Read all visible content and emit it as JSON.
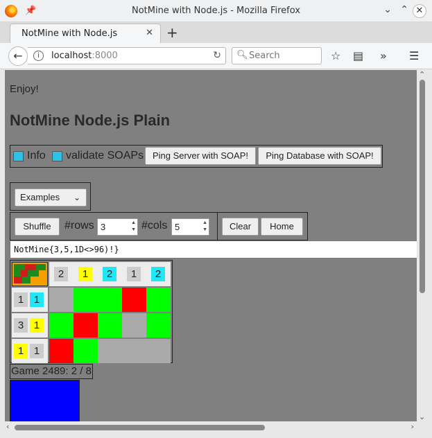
{
  "window": {
    "title": "NotMine with Node.js - Mozilla Firefox"
  },
  "tab": {
    "label": "NotMine with Node.js",
    "close": "✕"
  },
  "nav": {
    "url_host": "localhost",
    "url_port": ":8000",
    "search_placeholder": "Search"
  },
  "page": {
    "enjoy": "Enjoy!",
    "heading": "NotMine Node.js Plain",
    "info_label": "Info",
    "validate_label": "validate SOAPs",
    "ping_server": "Ping Server with SOAP!",
    "ping_database": "Ping Database with SOAP!",
    "examples_select": "Examples",
    "shuffle": "Shuffle",
    "rows_label": "#rows",
    "rows_value": "3",
    "cols_label": "#cols",
    "cols_value": "5",
    "clear": "Clear",
    "home": "Home",
    "code": "NotMine{3,5,1D<>96)!}",
    "status": "Game 2489: 2 / 8"
  },
  "colors": {
    "background": "#808080",
    "green": "#00ff00",
    "red": "#ff0000",
    "gray": "#aaaaaa",
    "yellow": "#ffff00",
    "cyan": "#22e5f5",
    "blue": "#0000ff",
    "hint_gray": "#cccccc"
  },
  "board": {
    "column_hints": [
      {
        "value": "2",
        "color": "#cccccc"
      },
      {
        "value": "1",
        "color": "#ffff00"
      },
      {
        "value": "2",
        "color": "#22e5f5"
      },
      {
        "value": "1",
        "color": "#cccccc"
      },
      {
        "value": "2",
        "color": "#22e5f5"
      }
    ],
    "row_hints": [
      [
        {
          "value": "1",
          "color": "#cccccc"
        },
        {
          "value": "1",
          "color": "#22e5f5"
        }
      ],
      [
        {
          "value": "3",
          "color": "#cccccc"
        },
        {
          "value": "1",
          "color": "#ffff00"
        }
      ],
      [
        {
          "value": "1",
          "color": "#ffff00"
        },
        {
          "value": "1",
          "color": "#cccccc"
        }
      ]
    ],
    "cells": [
      [
        "gray",
        "green",
        "green",
        "red",
        "green"
      ],
      [
        "green",
        "red",
        "green",
        "gray",
        "green"
      ],
      [
        "red",
        "green",
        "gray",
        "gray",
        "gray"
      ]
    ]
  }
}
